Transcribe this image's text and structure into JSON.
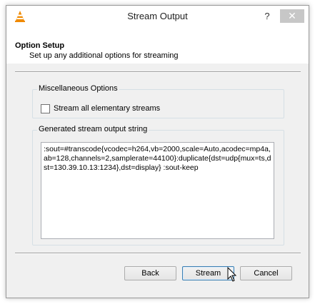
{
  "window": {
    "title": "Stream Output",
    "help_label": "?",
    "close_label": "✕"
  },
  "header": {
    "title": "Option Setup",
    "subtitle": "Set up any additional options for streaming"
  },
  "misc": {
    "group_label": "Miscellaneous Options",
    "checkbox_label": "Stream all elementary streams",
    "checked": false
  },
  "output": {
    "group_label": "Generated stream output string",
    "value": ":sout=#transcode{vcodec=h264,vb=2000,scale=Auto,acodec=mp4a,ab=128,channels=2,samplerate=44100}:duplicate{dst=udp{mux=ts,dst=130.39.10.13:1234},dst=display} :sout-keep"
  },
  "buttons": {
    "back": "Back",
    "stream": "Stream",
    "cancel": "Cancel"
  },
  "icons": {
    "app": "vlc-cone-icon",
    "cursor": "mouse-pointer-icon"
  },
  "colors": {
    "vlc_orange": "#f08a00",
    "default_button_border": "#3c7fb1"
  }
}
